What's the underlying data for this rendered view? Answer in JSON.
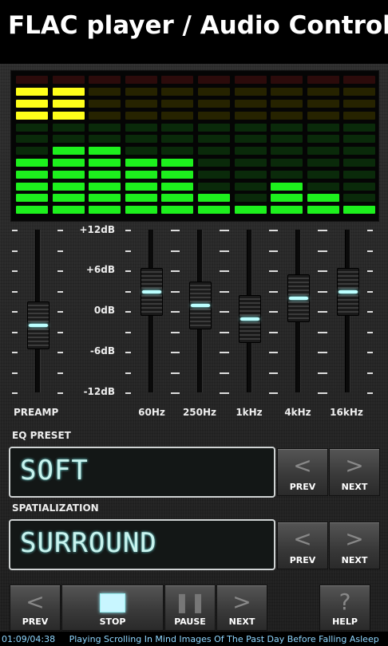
{
  "header": {
    "title": "FLAC player / Audio Controls"
  },
  "spectrum": {
    "columns": [
      {
        "green": 5,
        "yellow": 4
      },
      {
        "green": 6,
        "yellow": 4
      },
      {
        "green": 6,
        "yellow": 0
      },
      {
        "green": 5,
        "yellow": 0
      },
      {
        "green": 5,
        "yellow": 0
      },
      {
        "green": 2,
        "yellow": 0
      },
      {
        "green": 1,
        "yellow": 0
      },
      {
        "green": 3,
        "yellow": 0
      },
      {
        "green": 2,
        "yellow": 0
      },
      {
        "green": 1,
        "yellow": 0
      }
    ]
  },
  "equalizer": {
    "db_labels": [
      "+12dB",
      "+6dB",
      "0dB",
      "-6dB",
      "-12dB"
    ],
    "bands": [
      {
        "label": "PREAMP",
        "level_db": -2
      },
      {
        "label": "60Hz",
        "level_db": 3
      },
      {
        "label": "250Hz",
        "level_db": 1
      },
      {
        "label": "1kHz",
        "level_db": -1
      },
      {
        "label": "4kHz",
        "level_db": 2
      },
      {
        "label": "16kHz",
        "level_db": 3
      }
    ]
  },
  "eq_preset": {
    "heading": "EQ PRESET",
    "value": "SOFT",
    "prev_label": "PREV",
    "next_label": "NEXT"
  },
  "spatialization": {
    "heading": "SPATIALIZATION",
    "value": "SURROUND",
    "prev_label": "PREV",
    "next_label": "NEXT"
  },
  "transport": {
    "prev_label": "PREV",
    "stop_label": "STOP",
    "pause_label": "PAUSE",
    "next_label": "NEXT",
    "help_label": "HELP"
  },
  "status": {
    "time": "01:09/04:38",
    "now_playing": "Playing  Scrolling In Mind Images Of The Past Day Before Falling Asleep"
  },
  "colors": {
    "green_on": "#1df01d",
    "yellow_on": "#ffff1a",
    "accent_glow": "#bffcff"
  }
}
